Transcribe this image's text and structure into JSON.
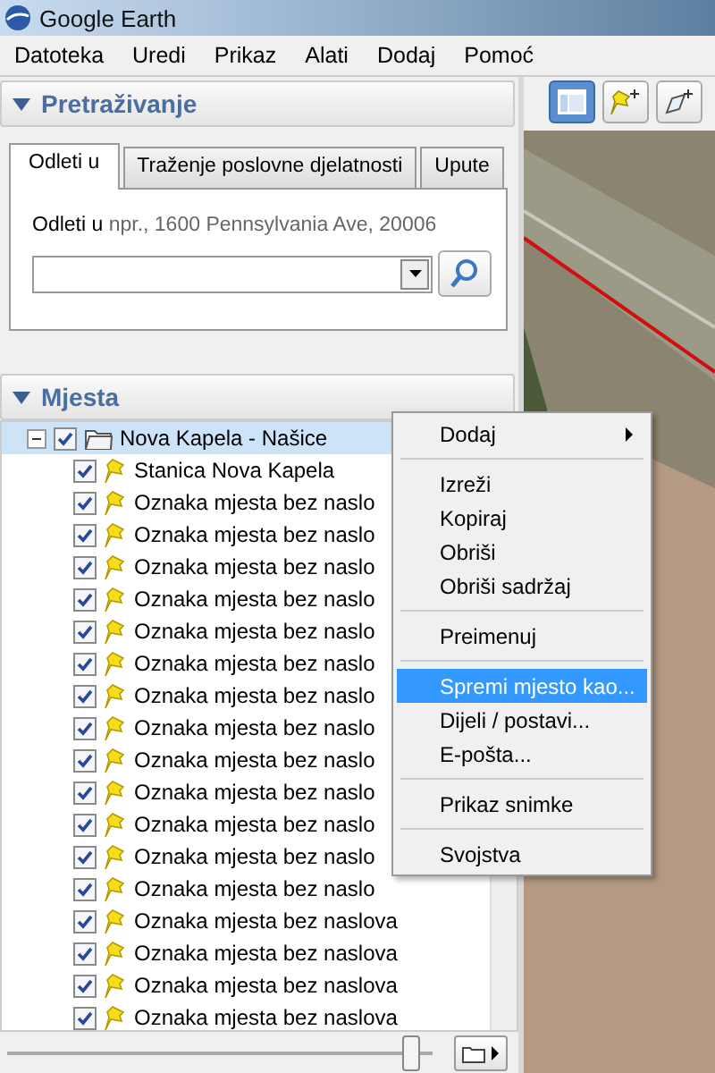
{
  "window": {
    "title": "Google Earth"
  },
  "menu": [
    "Datoteka",
    "Uredi",
    "Prikaz",
    "Alati",
    "Dodaj",
    "Pomoć"
  ],
  "search_panel": {
    "title": "Pretraživanje",
    "expanded": true,
    "tabs": [
      {
        "label": "Odleti u",
        "selected": true
      },
      {
        "label": "Traženje poslovne djelatnosti",
        "selected": false
      },
      {
        "label": "Upute",
        "selected": false
      }
    ],
    "label": "Odleti u",
    "hint": "npr., 1600 Pennsylvania Ave, 20006"
  },
  "places_panel": {
    "title": "Mjesta",
    "expanded": true,
    "tree": [
      {
        "label": "Nova Kapela - Našice",
        "kind": "folder",
        "checked": true,
        "selected": true,
        "expanded": true,
        "children": [
          {
            "label": "Stanica Nova Kapela",
            "kind": "placemark",
            "checked": true,
            "selected": false
          },
          {
            "label": "Oznaka mjesta bez naslo",
            "kind": "placemark",
            "checked": true,
            "selected": false
          },
          {
            "label": "Oznaka mjesta bez naslo",
            "kind": "placemark",
            "checked": true,
            "selected": false
          },
          {
            "label": "Oznaka mjesta bez naslo",
            "kind": "placemark",
            "checked": true,
            "selected": false
          },
          {
            "label": "Oznaka mjesta bez naslo",
            "kind": "placemark",
            "checked": true,
            "selected": false
          },
          {
            "label": "Oznaka mjesta bez naslo",
            "kind": "placemark",
            "checked": true,
            "selected": false
          },
          {
            "label": "Oznaka mjesta bez naslo",
            "kind": "placemark",
            "checked": true,
            "selected": false
          },
          {
            "label": "Oznaka mjesta bez naslo",
            "kind": "placemark",
            "checked": true,
            "selected": false
          },
          {
            "label": "Oznaka mjesta bez naslo",
            "kind": "placemark",
            "checked": true,
            "selected": false
          },
          {
            "label": "Oznaka mjesta bez naslo",
            "kind": "placemark",
            "checked": true,
            "selected": false
          },
          {
            "label": "Oznaka mjesta bez naslo",
            "kind": "placemark",
            "checked": true,
            "selected": false
          },
          {
            "label": "Oznaka mjesta bez naslo",
            "kind": "placemark",
            "checked": true,
            "selected": false
          },
          {
            "label": "Oznaka mjesta bez naslo",
            "kind": "placemark",
            "checked": true,
            "selected": false
          },
          {
            "label": "Oznaka mjesta bez naslo",
            "kind": "placemark",
            "checked": true,
            "selected": false
          },
          {
            "label": "Oznaka mjesta bez naslova",
            "kind": "placemark",
            "checked": true,
            "selected": false
          },
          {
            "label": "Oznaka mjesta bez naslova",
            "kind": "placemark",
            "checked": true,
            "selected": false
          },
          {
            "label": "Oznaka mjesta bez naslova",
            "kind": "placemark",
            "checked": true,
            "selected": false
          },
          {
            "label": "Oznaka mjesta bez naslova",
            "kind": "placemark",
            "checked": true,
            "selected": false
          }
        ]
      }
    ],
    "slider": {
      "level": 0.95
    }
  },
  "map_toolbar": [
    {
      "kind": "sidebar",
      "selected": true
    },
    {
      "kind": "placemark",
      "selected": false
    },
    {
      "kind": "polygon",
      "selected": false
    }
  ],
  "context_menu": [
    {
      "kind": "item",
      "label": "Dodaj",
      "submenu": true,
      "selected": false
    },
    {
      "kind": "separator"
    },
    {
      "kind": "item",
      "label": "Izreži",
      "submenu": false,
      "selected": false
    },
    {
      "kind": "item",
      "label": "Kopiraj",
      "submenu": false,
      "selected": false
    },
    {
      "kind": "item",
      "label": "Obriši",
      "submenu": false,
      "selected": false
    },
    {
      "kind": "item",
      "label": "Obriši sadržaj",
      "submenu": false,
      "selected": false
    },
    {
      "kind": "separator"
    },
    {
      "kind": "item",
      "label": "Preimenuj",
      "submenu": false,
      "selected": false
    },
    {
      "kind": "separator"
    },
    {
      "kind": "item",
      "label": "Spremi mjesto kao...",
      "submenu": false,
      "selected": true
    },
    {
      "kind": "item",
      "label": "Dijeli / postavi...",
      "submenu": false,
      "selected": false
    },
    {
      "kind": "item",
      "label": "E-pošta...",
      "submenu": false,
      "selected": false
    },
    {
      "kind": "separator"
    },
    {
      "kind": "item",
      "label": "Prikaz snimke",
      "submenu": false,
      "selected": false
    },
    {
      "kind": "separator"
    },
    {
      "kind": "item",
      "label": "Svojstva",
      "submenu": false,
      "selected": false
    }
  ]
}
